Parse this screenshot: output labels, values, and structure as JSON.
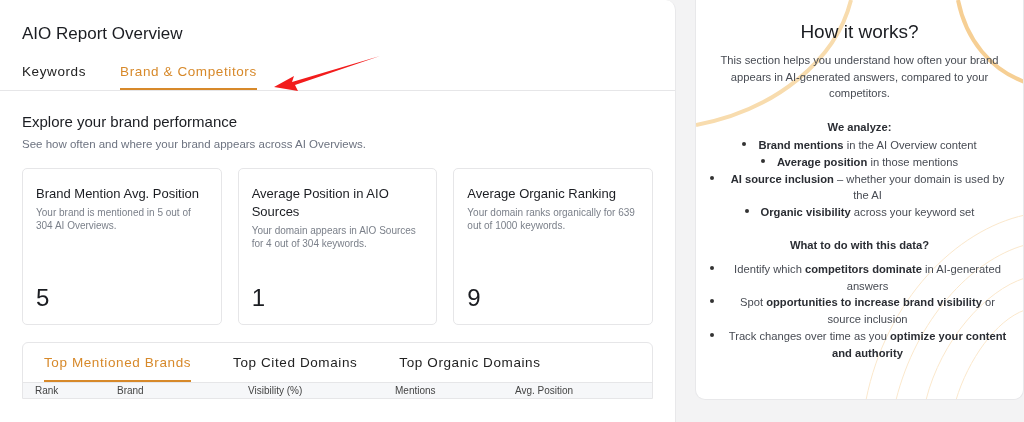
{
  "report": {
    "title": "AIO Report Overview",
    "tabs": [
      {
        "label": "Keywords",
        "selected": false
      },
      {
        "label": "Brand & Competitors",
        "selected": true
      }
    ],
    "section_title": "Explore your brand performance",
    "section_subtitle": "See how often and where your brand appears across AI Overviews.",
    "cards": [
      {
        "title": "Brand Mention Avg. Position",
        "description": "Your brand is mentioned in 5 out of 304 AI Overviews.",
        "value": "5"
      },
      {
        "title": "Average Position in AIO Sources",
        "description": "Your domain appears in AIO Sources for 4 out of 304 keywords.",
        "value": "1"
      },
      {
        "title": "Average Organic Ranking",
        "description": "Your domain ranks organically for 639 out of 1000 keywords.",
        "value": "9"
      }
    ],
    "table": {
      "tabs": [
        {
          "label": "Top Mentioned Brands",
          "selected": true
        },
        {
          "label": "Top Cited Domains",
          "selected": false
        },
        {
          "label": "Top Organic Domains",
          "selected": false
        }
      ],
      "columns": [
        "Rank",
        "Brand",
        "Visibility (%)",
        "Mentions",
        "Avg. Position"
      ]
    }
  },
  "how_it_works": {
    "title": "How it works?",
    "intro": "This section helps you understand how often your brand appears in AI-generated answers, compared to your competitors.",
    "analyze_heading": "We analyze:",
    "analyze_items": [
      "**Brand mentions** in the AI Overview content",
      "**Average position** in those mentions",
      "**AI source inclusion** – whether your domain is used by the AI",
      "**Organic visibility** across your keyword set"
    ],
    "todo_heading": "What to do with this data?",
    "todo_items": [
      "Identify which **competitors dominate** in AI-generated answers",
      "Spot **opportunities to increase brand visibility** or source inclusion",
      "Track changes over time as you **optimize your content and authority**"
    ]
  }
}
